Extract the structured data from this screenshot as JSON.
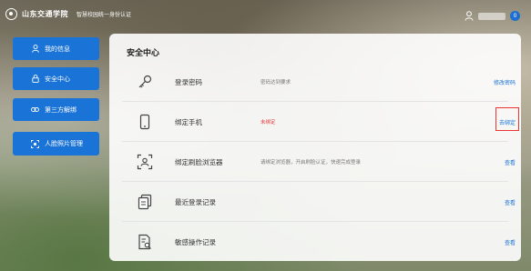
{
  "header": {
    "school_name": "山东交通学院",
    "auth_title": "智慧校园统一身份认证",
    "notification_count": "0"
  },
  "sidebar": {
    "items": [
      {
        "label": "我的信息",
        "icon": "user-icon"
      },
      {
        "label": "安全中心",
        "icon": "lock-icon"
      },
      {
        "label": "第三方解绑",
        "icon": "link-icon"
      },
      {
        "label": "人脸照片管理",
        "icon": "face-scan-icon"
      }
    ]
  },
  "security": {
    "title": "安全中心",
    "rows": [
      {
        "name": "登录密码",
        "desc": "密码达到要求",
        "action": "修改密码",
        "icon": "key-icon"
      },
      {
        "name": "绑定手机",
        "desc": "未绑定",
        "action": "去绑定",
        "icon": "phone-icon"
      },
      {
        "name": "绑定刷脸浏览器",
        "desc": "请绑定浏览器，开启刷脸认证，快速完成登录",
        "action": "查看",
        "icon": "face-scan-icon"
      },
      {
        "name": "最近登录记录",
        "desc": "",
        "action": "查看",
        "icon": "document-icon"
      },
      {
        "name": "敏感操作记录",
        "desc": "",
        "action": "查看",
        "icon": "document-search-icon"
      }
    ]
  },
  "colors": {
    "accent": "#1a73d6",
    "warning": "#e23b3b"
  }
}
